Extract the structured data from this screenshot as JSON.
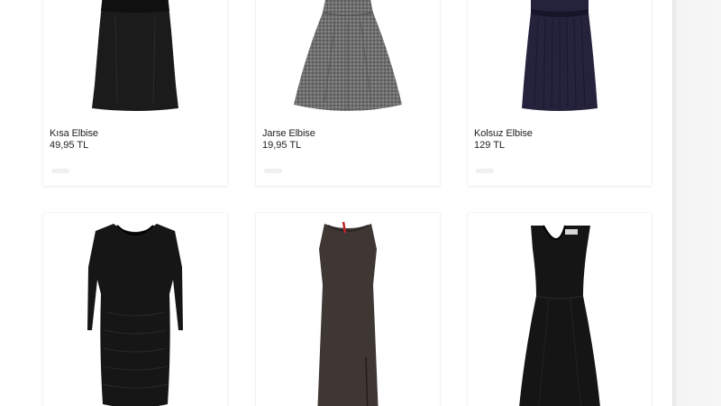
{
  "products_row1": [
    {
      "name": "Kısa Elbise",
      "price": "49,95 TL",
      "image_icon": "black-mini-dress-icon",
      "color": "#1a1a1a"
    },
    {
      "name": "Jarse Elbise",
      "price": "19,95 TL",
      "image_icon": "grey-flared-dress-icon",
      "color": "#6b6b6b"
    },
    {
      "name": "Kolsuz Elbise",
      "price": "129 TL",
      "image_icon": "navy-pleated-dress-icon",
      "color": "#23213a"
    }
  ],
  "products_row2": [
    {
      "image_icon": "black-ruched-long-sleeve-dress-icon",
      "color": "#141414"
    },
    {
      "image_icon": "brown-sleeveless-maxi-dress-icon",
      "color": "#3e3633"
    },
    {
      "image_icon": "black-sleeveless-flared-dress-icon",
      "color": "#151515"
    }
  ]
}
